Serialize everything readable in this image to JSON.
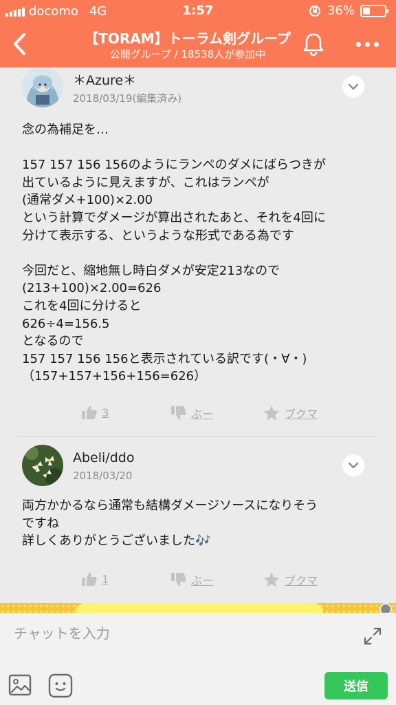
{
  "status_bar": {
    "carrier": "docomo",
    "network": "4G",
    "time": "1:57",
    "battery": "36%"
  },
  "header": {
    "title": "【TORAM】トーラム剣グループ",
    "subtitle": "公開グループ / 18538人が参加中"
  },
  "posts": [
    {
      "author": "＊Azure＊",
      "date": "2018/03/19(編集済み)",
      "lines": [
        "念の為補足を…",
        "",
        "157 157 156 156のようにランペのダメにばらつきが",
        "出ているように見えますが、これはランペが",
        "(通常ダメ+100)×2.00",
        "という計算でダメージが算出されたあと、それを4回に",
        "分けて表示する、というような形式である為です",
        "",
        "今回だと、縮地無し時白ダメが安定213なので",
        "(213+100)×2.00=626",
        "これを4回に分けると",
        "626÷4=156.5",
        "となるので",
        "157 157 156 156と表示されている訳です(・∀・)",
        "（157+157+156+156=626）"
      ],
      "like_count": "3",
      "boo_label": "ぶー",
      "bookmark_label": "ブクマ"
    },
    {
      "author": "Abeli/ddo",
      "date": "2018/03/20",
      "lines": [
        "両方かかるなら通常も結構ダメージソースになりそう",
        "ですね",
        "詳しくありがとうございました🎶"
      ],
      "like_count": "1",
      "boo_label": "ぶー",
      "bookmark_label": "ブクマ"
    }
  ],
  "chat": {
    "placeholder": "チャットを入力",
    "send_label": "送信"
  },
  "colors": {
    "header": "#fb7a55",
    "send": "#34c759",
    "action": "#aaaaaa"
  },
  "icons": [
    "back-icon",
    "bell-icon",
    "more-icon",
    "chevron-down-icon",
    "thumbs-up-icon",
    "thumbs-down-icon",
    "star-icon",
    "expand-icon",
    "image-icon",
    "emoji-icon"
  ]
}
